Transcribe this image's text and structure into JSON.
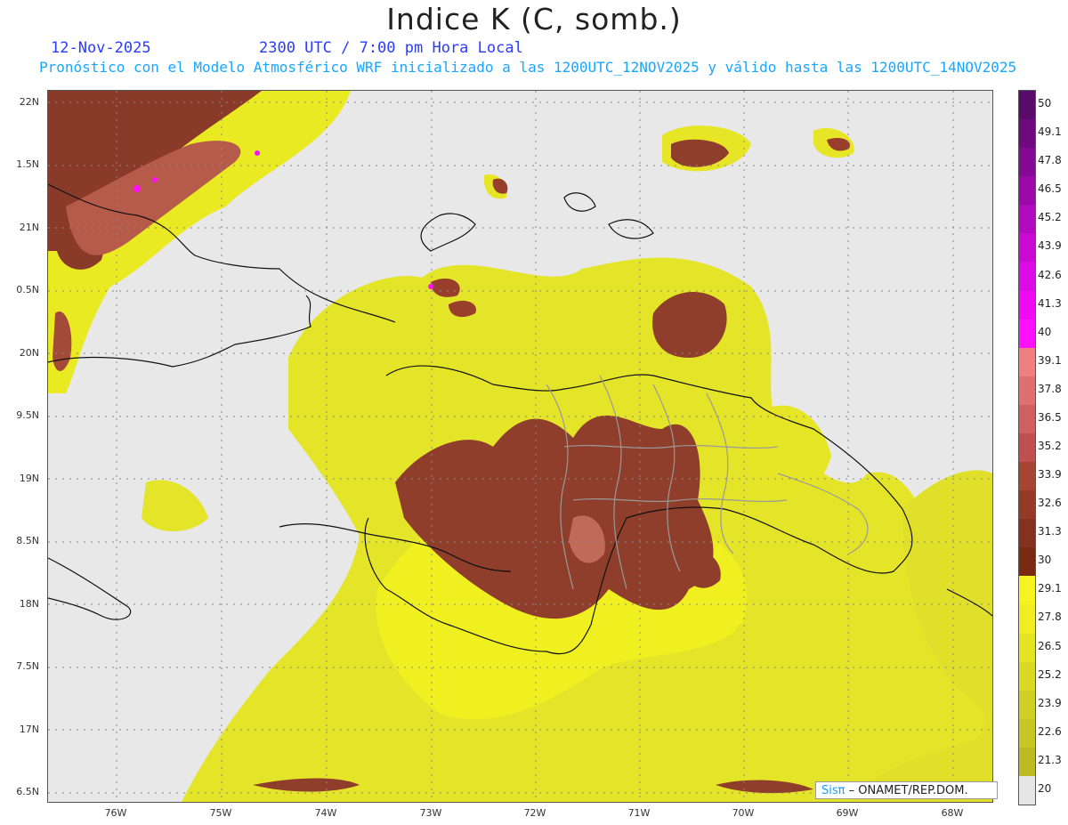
{
  "header": {
    "title": "Indice K (C, somb.)",
    "date": "12-Nov-2025",
    "time": "2300 UTC / 7:00 pm Hora Local",
    "subtitle": "Pronóstico con el Modelo Atmosférico WRF inicializado a las 1200UTC_12NOV2025 y válido hasta las  1200UTC_14NOV2025"
  },
  "map": {
    "lat_ticks": [
      "22N",
      "1.5N",
      "21N",
      "0.5N",
      "20N",
      "9.5N",
      "19N",
      "8.5N",
      "18N",
      "7.5N",
      "17N",
      "6.5N"
    ],
    "lon_ticks": [
      "76W",
      "75W",
      "74W",
      "73W",
      "72W",
      "71W",
      "70W",
      "69W",
      "68W"
    ],
    "lat_range": [
      16.4,
      22.1
    ],
    "lon_range": [
      -76.6,
      -67.6
    ],
    "background_color": "#e8e8e8"
  },
  "colorbar": {
    "labels": [
      "50",
      "49.1",
      "47.8",
      "46.5",
      "45.2",
      "43.9",
      "42.6",
      "41.3",
      "40",
      "39.1",
      "37.8",
      "36.5",
      "35.2",
      "33.9",
      "32.6",
      "31.3",
      "30",
      "29.1",
      "27.8",
      "26.5",
      "25.2",
      "23.9",
      "22.6",
      "21.3",
      "20"
    ],
    "colors": [
      "#5a0a6a",
      "#6e0a7e",
      "#840a94",
      "#9b0aa8",
      "#b20abf",
      "#c80ad2",
      "#dc0ae4",
      "#ef0af2",
      "#ff10ff",
      "#f08080",
      "#e07070",
      "#d06060",
      "#c05050",
      "#a84434",
      "#963a28",
      "#84321f",
      "#7a2a12",
      "#f4f420",
      "#eeee22",
      "#e4e424",
      "#dada24",
      "#d0d024",
      "#c6c624",
      "#bcbc22",
      "#e6e6e6"
    ]
  },
  "credit": {
    "sis": "Sisπ",
    "text": " – ONAMET/REP.DOM."
  }
}
